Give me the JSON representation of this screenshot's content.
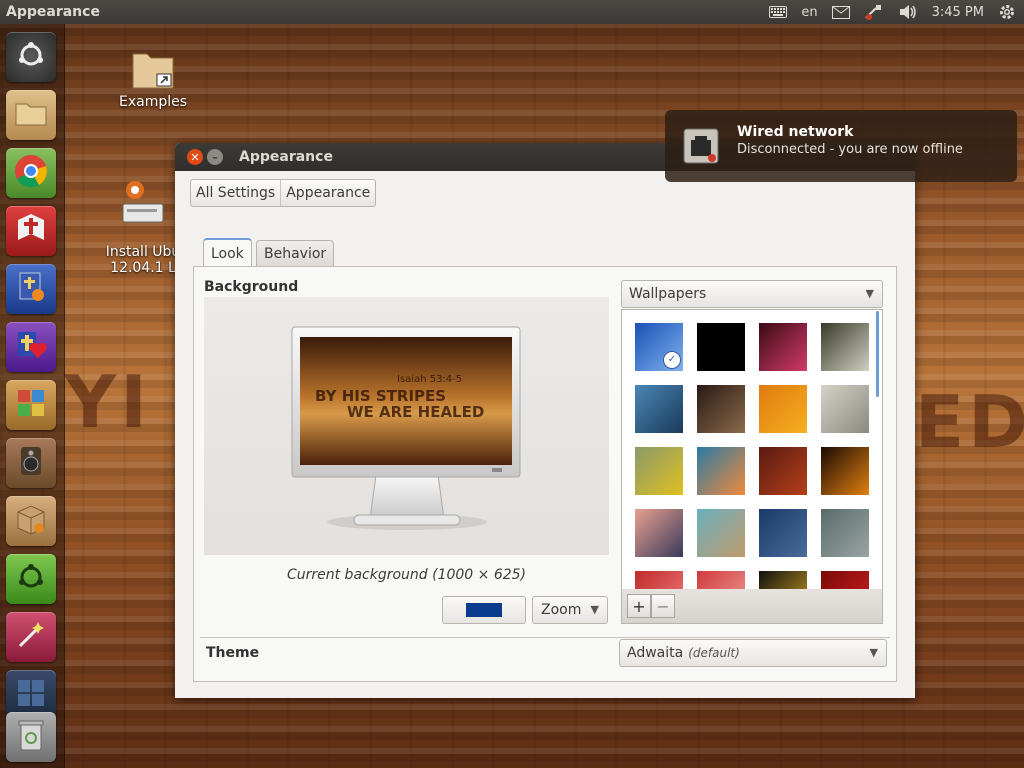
{
  "panel": {
    "app_title": "Appearance",
    "indicators": {
      "keyboard_layout": "en",
      "clock": "3:45 PM",
      "icons": [
        "keyboard-icon",
        "mail-icon",
        "network-offline-icon",
        "volume-icon",
        "gear-icon"
      ]
    }
  },
  "background_art": {
    "left_text": "YI",
    "right_text": "ED"
  },
  "launcher": {
    "items": [
      {
        "name": "dash-home",
        "icon": "ubuntu-logo-icon",
        "color": "#3a3a3a"
      },
      {
        "name": "files",
        "icon": "folder-icon",
        "color": "#c9a571"
      },
      {
        "name": "chrome",
        "icon": "chrome-icon",
        "color": "#4a9e3a"
      },
      {
        "name": "bible-app",
        "icon": "cross-book-icon",
        "color": "#c0282a"
      },
      {
        "name": "bible-study",
        "icon": "bible-clock-icon",
        "color": "#2c4fa3"
      },
      {
        "name": "christian-app",
        "icon": "cross-heart-icon",
        "color": "#7b3aa0"
      },
      {
        "name": "puzzle-app",
        "icon": "puzzle-icon",
        "color": "#c08a3a"
      },
      {
        "name": "speaker-app",
        "icon": "speaker-icon",
        "color": "#8a5a3a"
      },
      {
        "name": "package-installer",
        "icon": "package-icon",
        "color": "#b48a5a"
      },
      {
        "name": "ubuntu-software",
        "icon": "ubuntu-green-icon",
        "color": "#5ca83a"
      },
      {
        "name": "magic-wand-app",
        "icon": "wand-icon",
        "color": "#b23a5a"
      },
      {
        "name": "workspace-switcher",
        "icon": "workspace-icon",
        "color": "#2a3a5a"
      },
      {
        "name": "trash",
        "icon": "trash-icon",
        "color": "#8a8a8a"
      }
    ]
  },
  "desktop": {
    "icons": [
      {
        "label": "Examples",
        "icon": "folder-link-icon"
      },
      {
        "label": "Install Ubu\n12.04.1 L",
        "icon": "installer-icon"
      }
    ]
  },
  "notification": {
    "title": "Wired network",
    "body": "Disconnected - you are now offline",
    "icon": "network-offline-icon"
  },
  "window": {
    "title": "Appearance",
    "breadcrumbs": [
      "All Settings",
      "Appearance"
    ],
    "tabs": [
      {
        "label": "Look",
        "active": true
      },
      {
        "label": "Behavior",
        "active": false
      }
    ],
    "background_section": {
      "heading": "Background",
      "preview_caption": "Current background (1000 × 625)",
      "preview_lines": [
        "Isaiah 53:4-5",
        "BY HIS STRIPES",
        "WE ARE HEALED"
      ],
      "color_swatch": "#0b3b8c",
      "scale_option": "Zoom",
      "source_option": "Wallpapers"
    },
    "wallpapers": {
      "selected_index": 0,
      "thumbnails": [
        {
          "color_a": "#1b4fb5",
          "color_b": "#7fb3ef"
        },
        {
          "color_a": "#000000",
          "color_b": "#000000"
        },
        {
          "color_a": "#3a0a14",
          "color_b": "#d23a6a"
        },
        {
          "color_a": "#3a3a2a",
          "color_b": "#cfd0c2"
        },
        {
          "color_a": "#4a86b5",
          "color_b": "#1a3a5a"
        },
        {
          "color_a": "#2a1a14",
          "color_b": "#8a6a4a"
        },
        {
          "color_a": "#e07a10",
          "color_b": "#f5b020"
        },
        {
          "color_a": "#d5d2c8",
          "color_b": "#8a8a80"
        },
        {
          "color_a": "#8a9a6a",
          "color_b": "#e0c020"
        },
        {
          "color_a": "#2a7aa5",
          "color_b": "#f08a3a"
        },
        {
          "color_a": "#5a1a10",
          "color_b": "#b5401a"
        },
        {
          "color_a": "#1a0a05",
          "color_b": "#e08010"
        },
        {
          "color_a": "#e8a090",
          "color_b": "#3a3a5a"
        },
        {
          "color_a": "#6ab0c0",
          "color_b": "#c09a6a"
        },
        {
          "color_a": "#1a3a6a",
          "color_b": "#4a6a9a"
        },
        {
          "color_a": "#5a6a6a",
          "color_b": "#9aa5a5"
        },
        {
          "color_a": "#c02a2a",
          "color_b": "#f08080"
        },
        {
          "color_a": "#d03a3a",
          "color_b": "#f0a0a0"
        },
        {
          "color_a": "#101010",
          "color_b": "#d0a020"
        },
        {
          "color_a": "#7a0a0a",
          "color_b": "#d02020"
        }
      ],
      "add_label": "+",
      "remove_label": "−"
    },
    "theme_section": {
      "heading": "Theme",
      "value": "Adwaita",
      "value_note": "(default)"
    }
  }
}
